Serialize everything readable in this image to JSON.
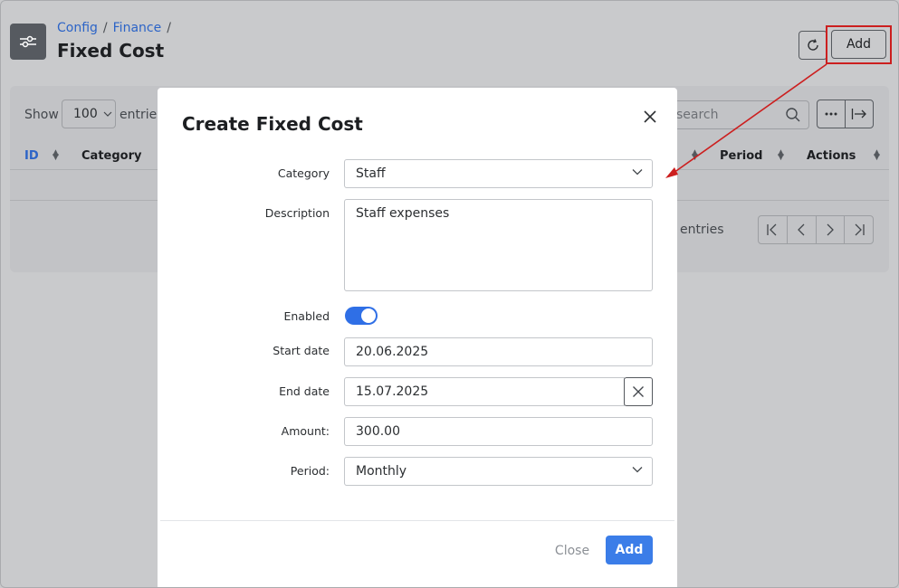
{
  "breadcrumb": {
    "items": [
      "Config",
      "Finance"
    ]
  },
  "page": {
    "title": "Fixed Cost"
  },
  "toolbar": {
    "refresh_icon": "refresh-icon",
    "add_label": "Add"
  },
  "table_controls": {
    "show_label": "Show",
    "page_size": "100",
    "entries_label": "entries",
    "search_placeholder": "search",
    "info_text": "entries"
  },
  "table": {
    "columns": [
      "ID",
      "Category",
      "Period",
      "Actions"
    ]
  },
  "modal": {
    "title": "Create Fixed Cost",
    "fields": {
      "category": {
        "label": "Category",
        "value": "Staff"
      },
      "description": {
        "label": "Description",
        "value": "Staff expenses"
      },
      "enabled": {
        "label": "Enabled",
        "value": true
      },
      "start_date": {
        "label": "Start date",
        "value": "20.06.2025"
      },
      "end_date": {
        "label": "End date",
        "value": "15.07.2025"
      },
      "amount": {
        "label": "Amount:",
        "value": "300.00"
      },
      "period": {
        "label": "Period:",
        "value": "Monthly"
      }
    },
    "close_label": "Close",
    "add_label": "Add"
  },
  "colors": {
    "accent": "#3b7de8",
    "highlight": "#cc1f1f",
    "link": "#2c64c7"
  }
}
